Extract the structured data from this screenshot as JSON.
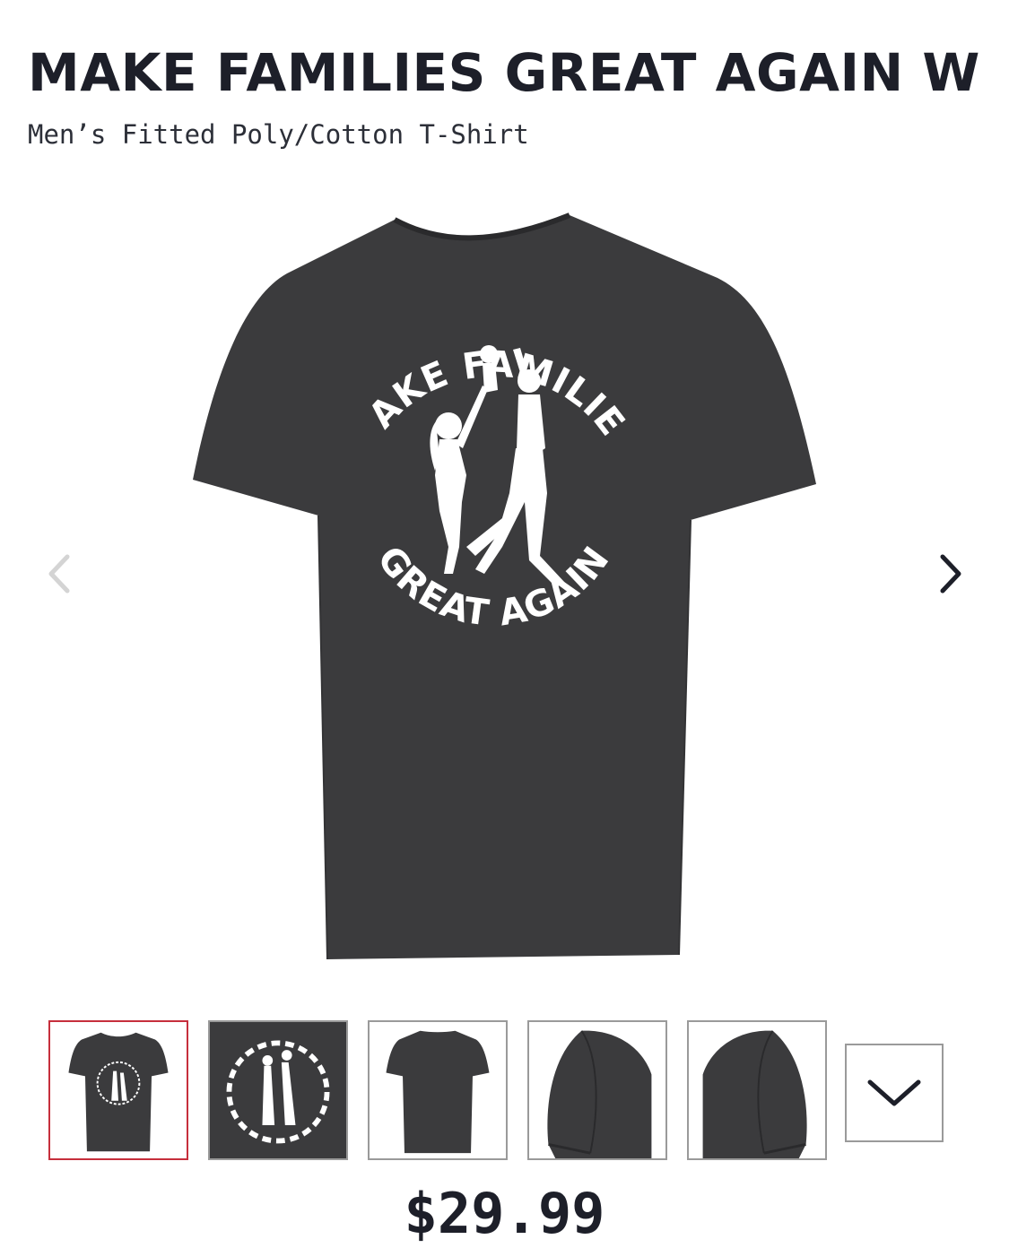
{
  "product": {
    "title": "MAKE FAMILIES GREAT AGAIN W",
    "subtitle": "Men’s Fitted Poly/Cotton T-Shirt",
    "price": "$29.99"
  },
  "design": {
    "top_text": "MAKE FAMILIES",
    "bottom_text": "GREAT AGAIN"
  },
  "carousel": {
    "prev_icon": "chevron-left-icon",
    "next_icon": "chevron-right-icon"
  },
  "thumbnails": {
    "items": [
      {
        "view": "front",
        "selected": true
      },
      {
        "view": "design-closeup",
        "selected": false
      },
      {
        "view": "back",
        "selected": false
      },
      {
        "view": "left-sleeve",
        "selected": false
      },
      {
        "view": "right-sleeve",
        "selected": false
      }
    ],
    "more_icon": "chevron-down-icon"
  },
  "colors": {
    "shirt": "#3b3b3d",
    "selected_border": "#c62f3c",
    "text": "#1d1f29"
  }
}
